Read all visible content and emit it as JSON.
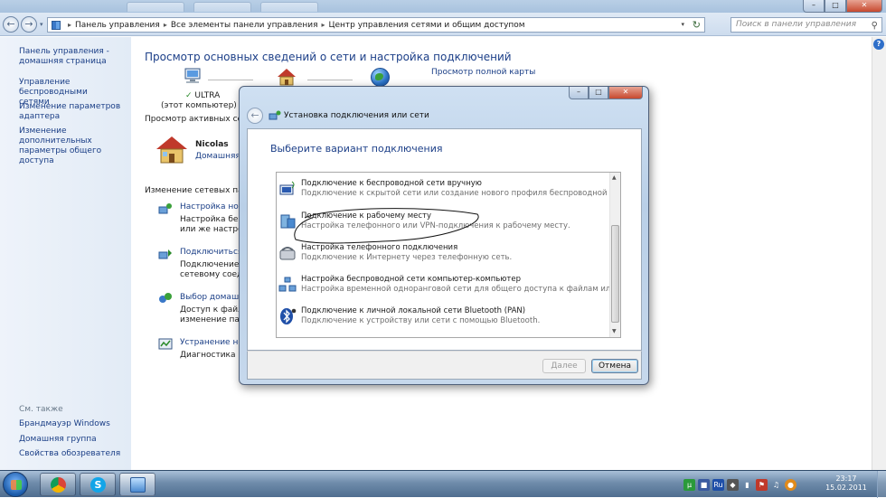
{
  "explorer": {
    "address": {
      "crumbs": [
        "Панель управления",
        "Все элементы панели управления",
        "Центр управления сетями и общим доступом"
      ]
    },
    "search": {
      "placeholder": "Поиск в панели управления"
    },
    "left_pane": {
      "home_line1": "Панель управления -",
      "home_line2": "домашняя страница",
      "links": [
        {
          "line1": "Управление беспроводными",
          "line2": "сетями"
        },
        {
          "line1": "Изменение параметров",
          "line2": "адаптера"
        },
        {
          "line1": "Изменение дополнительных",
          "line2": "параметры общего доступа"
        }
      ],
      "see_also": "См. также",
      "see_also_links": [
        "Брандмауэр Windows",
        "Домашняя группа",
        "Свойства обозревателя"
      ]
    },
    "main": {
      "title": "Просмотр основных сведений о сети и настройка подключений",
      "full_map_link": "Просмотр полной карты",
      "computer_name": "ULTRA",
      "computer_sub": "(этот компьютер)",
      "active_networks": "Просмотр активных сете",
      "network_name": "Nicolas",
      "network_type": "Домашняя с",
      "change_settings": "Изменение сетевых парам",
      "tasks": [
        {
          "link": "Настройка нового",
          "desc1": "Настройка беспр",
          "desc2": "или же настройк"
        },
        {
          "link": "Подключиться к",
          "desc1": "Подключение ил",
          "desc2": "сетевому соедин"
        },
        {
          "link": "Выбор домашне",
          "desc1": "Доступ к файла",
          "desc2": "изменение пара"
        },
        {
          "link": "Устранение непо",
          "desc1": "Диагностика и и",
          "desc2": ""
        }
      ]
    }
  },
  "dialog": {
    "title": "Установка подключения или сети",
    "heading": "Выберите вариант подключения",
    "options": [
      {
        "title": "Подключение к беспроводной сети вручную",
        "desc": "Подключение к скрытой сети или создание нового профиля беспроводной связи.",
        "icon": "wireless-network-icon"
      },
      {
        "title": "Подключение к рабочему месту",
        "desc": "Настройка телефонного или VPN-подключения к рабочему месту.",
        "icon": "workplace-icon"
      },
      {
        "title": "Настройка телефонного подключения",
        "desc": "Подключение к Интернету через телефонную сеть.",
        "icon": "dialup-phone-icon"
      },
      {
        "title": "Настройка беспроводной сети компьютер-компьютер",
        "desc": "Настройка временной одноранговой сети для общего доступа к файлам или к Инт...",
        "icon": "adhoc-network-icon"
      },
      {
        "title": "Подключение к личной локальной сети Bluetooth (PAN)",
        "desc": "Подключение к устройству или сети с помощью Bluetooth.",
        "icon": "bluetooth-icon"
      }
    ],
    "next_label": "Далее",
    "cancel_label": "Отмена"
  },
  "taskbar": {
    "time": "23:17",
    "date": "15.02.2011",
    "lang": "Ru"
  },
  "colors": {
    "link": "#1a3e86",
    "title": "#1c3f88",
    "taskbar": "#4f6d8f"
  }
}
